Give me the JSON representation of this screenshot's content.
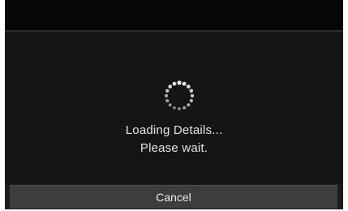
{
  "dialog": {
    "message_line1": "Loading Details...",
    "message_line2": "Please wait.",
    "cancel_label": "Cancel"
  },
  "icons": {
    "spinner": "loading-spinner-icon"
  },
  "colors": {
    "background": "#151515",
    "top_bar": "#060606",
    "button": "#3d3d3d",
    "text": "#e4e4e4"
  }
}
